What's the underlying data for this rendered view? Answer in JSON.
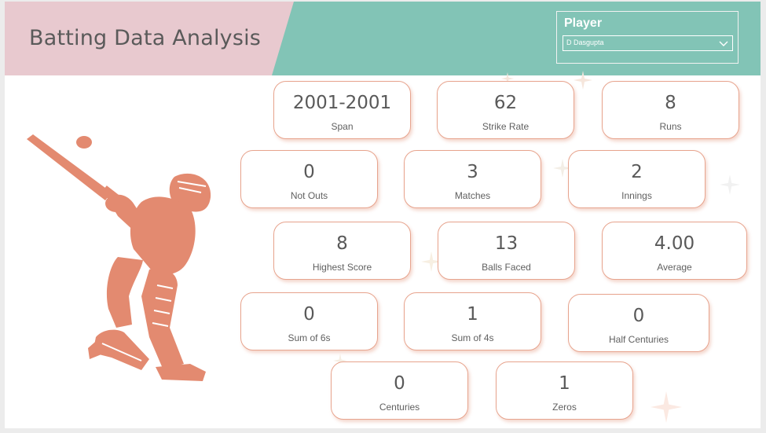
{
  "header": {
    "title": "Batting Data Analysis"
  },
  "player_slicer": {
    "label": "Player",
    "selected": "D Dasgupta"
  },
  "colors": {
    "teal": "#82c4b6",
    "pink": "#e8c9cf",
    "accent": "#e38a70"
  },
  "stats": {
    "span": {
      "value": "2001-2001",
      "label": "Span"
    },
    "strike_rate": {
      "value": "62",
      "label": "Strike Rate"
    },
    "runs": {
      "value": "8",
      "label": "Runs"
    },
    "not_outs": {
      "value": "0",
      "label": "Not Outs"
    },
    "matches": {
      "value": "3",
      "label": "Matches"
    },
    "innings": {
      "value": "2",
      "label": "Innings"
    },
    "highest_score": {
      "value": "8",
      "label": "Highest Score"
    },
    "balls_faced": {
      "value": "13",
      "label": "Balls Faced"
    },
    "average": {
      "value": "4.00",
      "label": "Average"
    },
    "sixes": {
      "value": "0",
      "label": "Sum of 6s"
    },
    "fours": {
      "value": "1",
      "label": "Sum of 4s"
    },
    "half_centuries": {
      "value": "0",
      "label": "Half Centuries"
    },
    "centuries": {
      "value": "0",
      "label": "Centuries"
    },
    "zeros": {
      "value": "1",
      "label": "Zeros"
    }
  }
}
